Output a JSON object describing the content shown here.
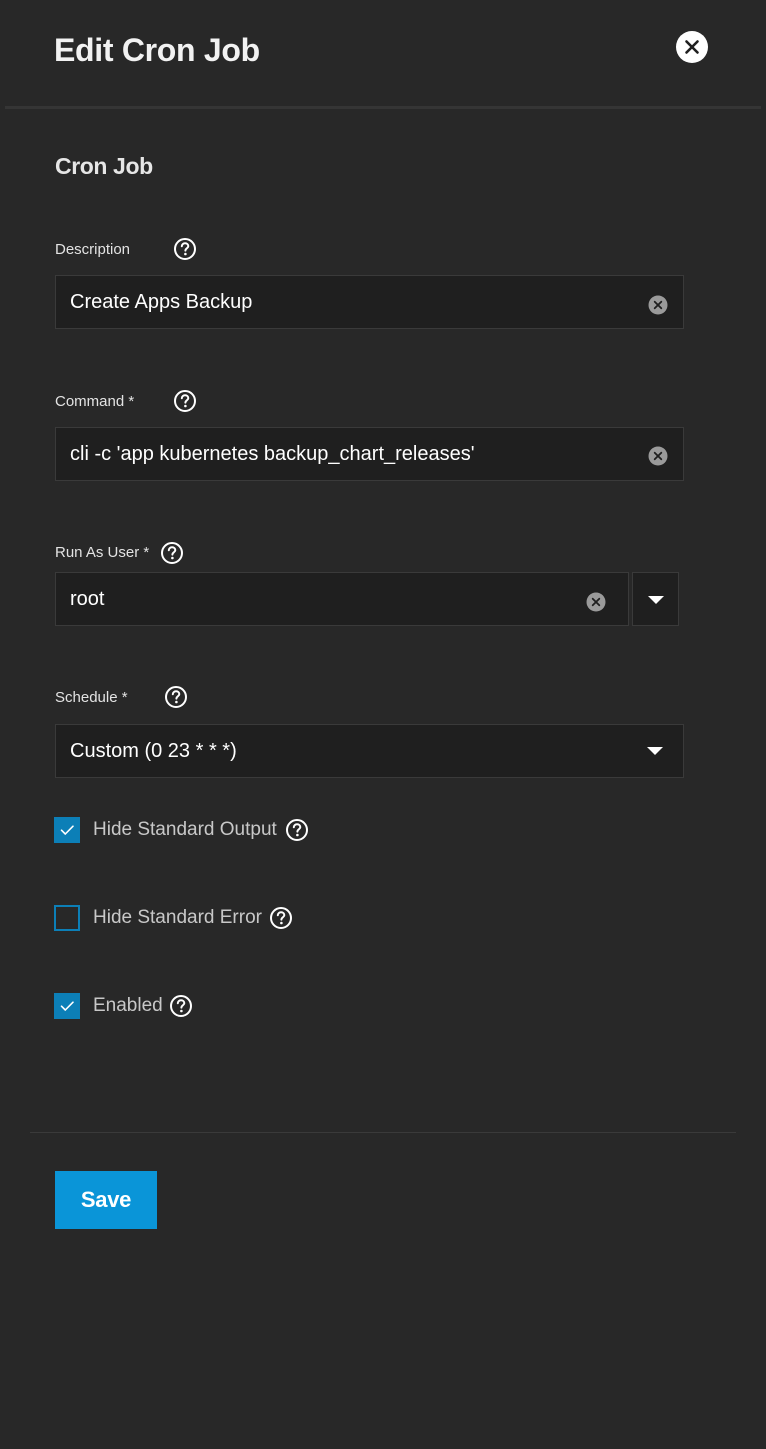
{
  "header": {
    "title": "Edit Cron Job",
    "close_icon": "close-icon"
  },
  "section": {
    "title": "Cron Job"
  },
  "fields": {
    "description": {
      "label": "Description",
      "value": "Create Apps Backup"
    },
    "command": {
      "label": "Command *",
      "value": "cli -c 'app kubernetes backup_chart_releases'"
    },
    "run_as_user": {
      "label": "Run As User *",
      "value": "root"
    },
    "schedule": {
      "label": "Schedule *",
      "value": "Custom (0 23 * * *)"
    }
  },
  "checkboxes": {
    "hide_stdout": {
      "label": "Hide Standard Output",
      "checked": true
    },
    "hide_stderr": {
      "label": "Hide Standard Error",
      "checked": false
    },
    "enabled": {
      "label": "Enabled",
      "checked": true
    }
  },
  "footer": {
    "save_label": "Save"
  },
  "colors": {
    "background": "#282828",
    "input_bg": "#1f1f1f",
    "accent": "#0c7fb7",
    "save_button": "#0a95d8"
  }
}
